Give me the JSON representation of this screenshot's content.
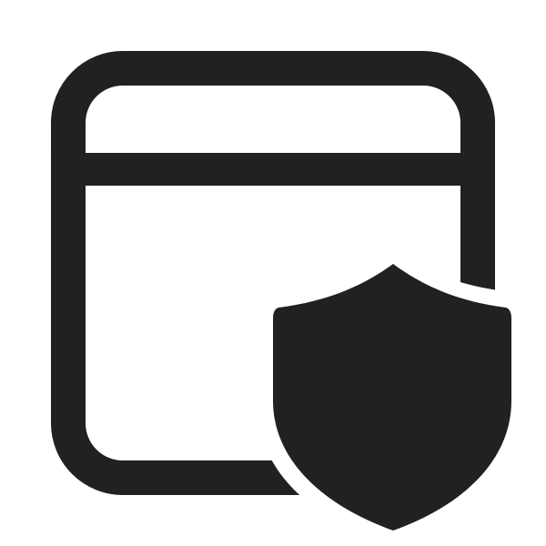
{
  "icon": {
    "name": "window-shield-icon",
    "parts": [
      "browser-window-icon",
      "shield-icon"
    ],
    "color": "#212121",
    "background": "#ffffff"
  }
}
